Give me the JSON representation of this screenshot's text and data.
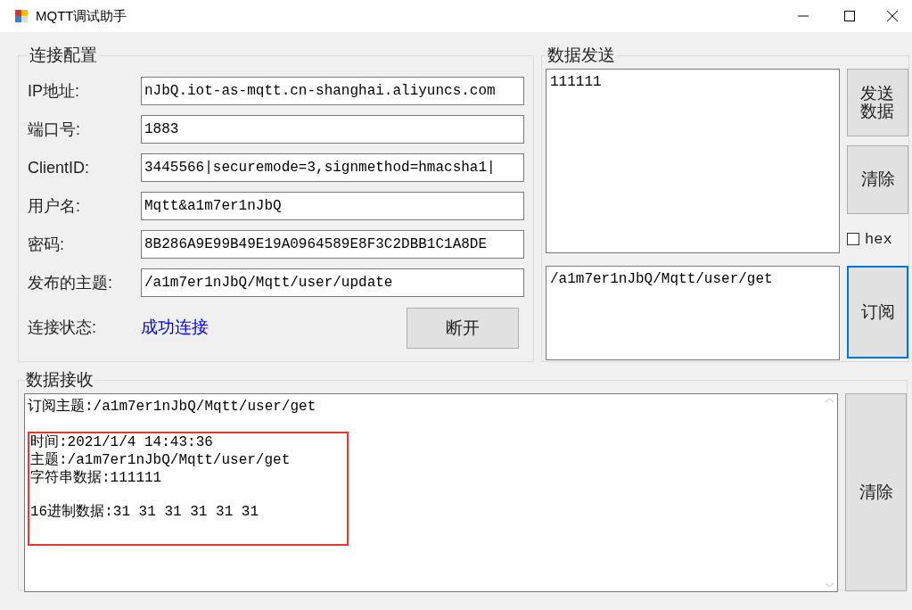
{
  "window": {
    "title": "MQTT调试助手"
  },
  "connection": {
    "legend": "连接配置",
    "fields": [
      {
        "label": "IP地址:",
        "value": "nJbQ.iot-as-mqtt.cn-shanghai.aliyuncs.com"
      },
      {
        "label": "端口号:",
        "value": "1883"
      },
      {
        "label": "ClientID:",
        "value": "3445566|securemode=3,signmethod=hmacsha1|"
      },
      {
        "label": "用户名:",
        "value": "Mqtt&a1m7er1nJbQ"
      },
      {
        "label": "密码:",
        "value": "8B286A9E99B49E19A0964589E8F3C2DBB1C1A8DE"
      },
      {
        "label": "发布的主题:",
        "value": "/a1m7er1nJbQ/Mqtt/user/update"
      }
    ],
    "status_label": "连接状态:",
    "status": "成功连接",
    "disconnect_button": "断开"
  },
  "send": {
    "legend": "数据发送",
    "message": "111111",
    "send_button": "发送数据",
    "clear_button": "清除",
    "hex": {
      "label": "hex",
      "checked": false
    },
    "subscribe_topic": "/a1m7er1nJbQ/Mqtt/user/get",
    "subscribe_button": {
      "label": "订阅",
      "focused": true
    }
  },
  "receive": {
    "legend": "数据接收",
    "clear_button": "清除",
    "blocks": [
      {
        "highlighted": false,
        "paragraphs": [
          [
            "订阅主题:/a1m7er1nJbQ/Mqtt/user/get"
          ]
        ]
      },
      {
        "highlighted": true,
        "paragraphs": [
          [
            "时间:2021/1/4 14:43:36",
            "主题:/a1m7er1nJbQ/Mqtt/user/get",
            "字符串数据:111111"
          ],
          [
            "16进制数据:31 31 31 31 31 31"
          ]
        ]
      }
    ]
  }
}
